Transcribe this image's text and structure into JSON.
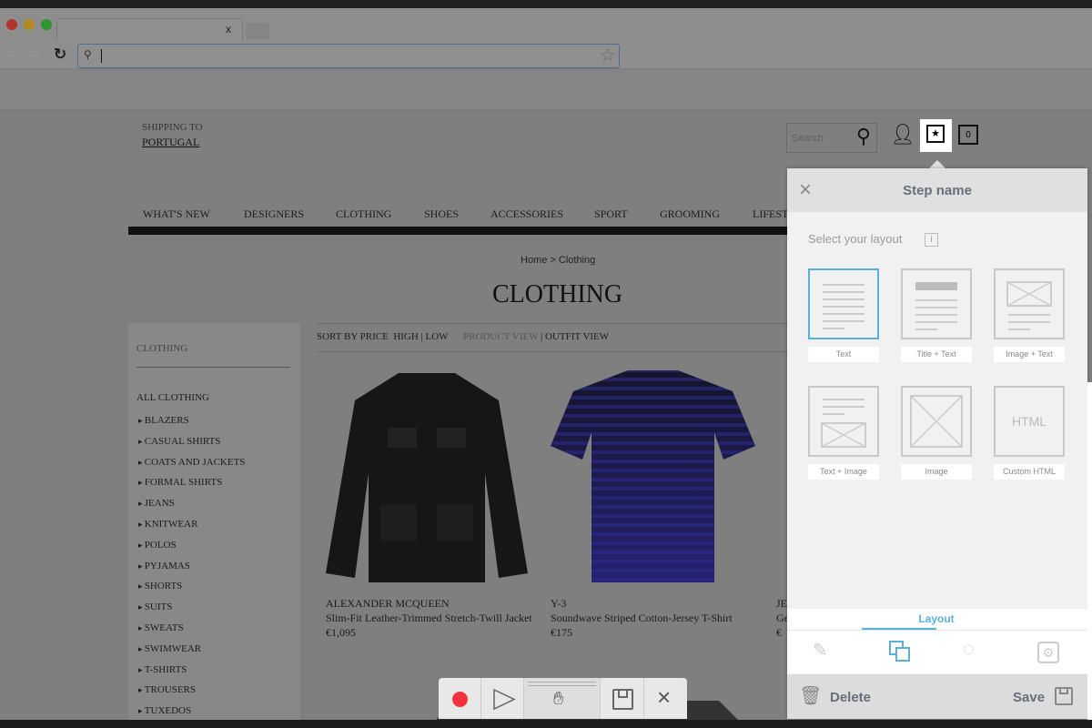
{
  "browser": {
    "tab_close": "x"
  },
  "site": {
    "shipping_label": "SHIPPING TO",
    "shipping_country": "PORTUGAL",
    "search_placeholder": "Search",
    "bag_count": "0",
    "nav": [
      "WHAT'S NEW",
      "DESIGNERS",
      "CLOTHING",
      "SHOES",
      "ACCESSORIES",
      "SPORT",
      "GROOMING",
      "LIFEST"
    ],
    "breadcrumb": "Home >  Clothing",
    "title": "CLOTHING",
    "sort_label": "SORT BY PRICE",
    "sort_high": "HIGH",
    "sort_low": "LOW",
    "product_view": "PRODUCT VIEW",
    "outfit_view": "OUTFIT VIEW",
    "sidebar_title": "CLOTHING",
    "all_clothing": "ALL CLOTHING",
    "categories": [
      "BLAZERS",
      "CASUAL SHIRTS",
      "COATS AND JACKETS",
      "FORMAL SHIRTS",
      "JEANS",
      "KNITWEAR",
      "POLOS",
      "PYJAMAS",
      "SHORTS",
      "SUITS",
      "SWEATS",
      "SWIMWEAR",
      "T-SHIRTS",
      "TROUSERS",
      "TUXEDOS"
    ],
    "products": [
      {
        "brand": "ALEXANDER MCQUEEN",
        "name": "Slim-Fit Leather-Trimmed Stretch-Twill Jacket",
        "price": "€1,095"
      },
      {
        "brand": "Y-3",
        "name": "Soundwave Striped Cotton-Jersey T-Shirt",
        "price": "€175"
      },
      {
        "brand": "JE",
        "name": "Ge",
        "price": "€"
      }
    ]
  },
  "panel": {
    "title": "Step name",
    "subtitle": "Select your layout",
    "info": "i",
    "layouts": [
      "Text",
      "Title + Text",
      "Image + Text",
      "Text + Image",
      "Image",
      "Custom HTML"
    ],
    "html_label": "HTML",
    "active_tab": "Layout",
    "delete": "Delete",
    "save": "Save",
    "accent": "#5ab0dc"
  },
  "toolbar": {
    "record_color": "#f2323c"
  }
}
